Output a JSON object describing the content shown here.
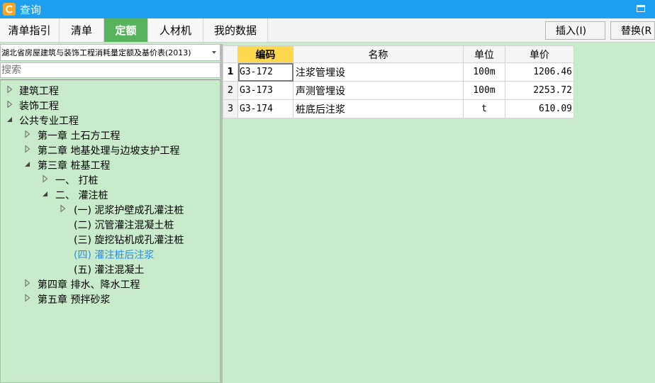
{
  "window": {
    "title": "查询"
  },
  "tabs": [
    {
      "label": "清单指引"
    },
    {
      "label": "清单"
    },
    {
      "label": "定额",
      "active": true
    },
    {
      "label": "人材机"
    },
    {
      "label": "我的数据"
    }
  ],
  "toolbar": {
    "insert_label": "插入(I)",
    "replace_label": "替换(R"
  },
  "library": {
    "selected": "湖北省房屋建筑与装饰工程消耗量定额及基价表(2013)"
  },
  "search": {
    "placeholder": "搜索"
  },
  "tree": [
    {
      "label": "建筑工程",
      "expanded": false,
      "level": 0
    },
    {
      "label": "装饰工程",
      "expanded": false,
      "level": 0
    },
    {
      "label": "公共专业工程",
      "expanded": true,
      "level": 0
    },
    {
      "label": "第一章  土石方工程",
      "expanded": false,
      "level": 1
    },
    {
      "label": "第二章  地基处理与边坡支护工程",
      "expanded": false,
      "level": 1
    },
    {
      "label": "第三章  桩基工程",
      "expanded": true,
      "level": 1
    },
    {
      "label": "一、  打桩",
      "expanded": false,
      "level": 2
    },
    {
      "label": "二、  灌注桩",
      "expanded": true,
      "level": 2
    },
    {
      "label": "(一) 泥浆护壁成孔灌注桩",
      "expanded": false,
      "level": 3
    },
    {
      "label": "(二) 沉管灌注混凝土桩",
      "leaf": true,
      "level": 3
    },
    {
      "label": "(三) 旋挖钻机成孔灌注桩",
      "leaf": true,
      "level": 3
    },
    {
      "label": "(四) 灌注桩后注浆",
      "leaf": true,
      "level": 3,
      "selected": true
    },
    {
      "label": "(五) 灌注混凝土",
      "leaf": true,
      "level": 3
    },
    {
      "label": "第四章  排水、降水工程",
      "expanded": false,
      "level": 1
    },
    {
      "label": "第五章  预拌砂浆",
      "expanded": false,
      "level": 1
    }
  ],
  "table": {
    "columns": [
      "编码",
      "名称",
      "单位",
      "单价"
    ],
    "rows": [
      {
        "num": "1",
        "code": "G3-172",
        "name": "注浆管埋设",
        "unit": "100m",
        "price": "1206.46",
        "current": true
      },
      {
        "num": "2",
        "code": "G3-173",
        "name": "声测管埋设",
        "unit": "100m",
        "price": "2253.72"
      },
      {
        "num": "3",
        "code": "G3-174",
        "name": "桩底后注浆",
        "unit": "t",
        "price": "610.09"
      }
    ]
  },
  "colors": {
    "titlebar": "#1e9fef",
    "active_tab": "#57b35c",
    "panel_bg": "#c8ebcc",
    "selected_text": "#2a8ce8",
    "header_highlight": "#ffd84d"
  }
}
